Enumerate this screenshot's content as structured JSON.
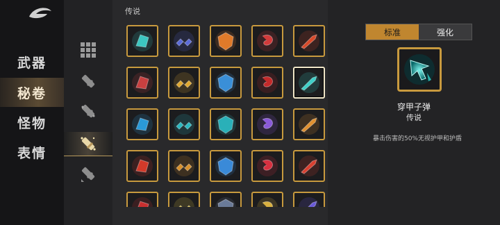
{
  "sidebar": {
    "items": [
      {
        "label": "武器"
      },
      {
        "label": "秘卷"
      },
      {
        "label": "怪物"
      },
      {
        "label": "表情"
      }
    ],
    "active_index": 1
  },
  "subcategories": {
    "icons": [
      "grid-icon",
      "bullet-icon",
      "bullet-spark-icon",
      "bullet-glow-icon",
      "bullet-arrows-icon"
    ],
    "active_index": 3
  },
  "grid": {
    "section_title": "传说",
    "items": [
      {
        "icon": "cyan-boot-icon",
        "color": "#3cc7c0"
      },
      {
        "icon": "chain-icon",
        "color": "#5a6ad8"
      },
      {
        "icon": "orange-shield-icon",
        "color": "#e07a2a"
      },
      {
        "icon": "red-teal-swirl-icon",
        "color": "#d23b3b"
      },
      {
        "icon": "red-gun-icon",
        "color": "#d94a2a"
      },
      {
        "icon": "axe-icon",
        "color": "#c84040"
      },
      {
        "icon": "gold-badge-icon",
        "color": "#e0a830"
      },
      {
        "icon": "blue-cat-icon",
        "color": "#3a8fd8"
      },
      {
        "icon": "red-target-icon",
        "color": "#c42a2a"
      },
      {
        "icon": "armor-piercing-bullet-icon",
        "color": "#3fd0c8"
      },
      {
        "icon": "blue-armor-icon",
        "color": "#2a9ad8"
      },
      {
        "icon": "teal-hook-icon",
        "color": "#2ab8c0"
      },
      {
        "icon": "teal-ring-icon",
        "color": "#2ab0b8"
      },
      {
        "icon": "purple-dash-icon",
        "color": "#8a5ad8"
      },
      {
        "icon": "fire-arrow-icon",
        "color": "#e09030"
      },
      {
        "icon": "red-slash-icon",
        "color": "#d23a2a"
      },
      {
        "icon": "gold-shield-icon",
        "color": "#d8902a"
      },
      {
        "icon": "blue-pixel-icon",
        "color": "#3a8ad8"
      },
      {
        "icon": "red-heart-icon",
        "color": "#d83040"
      },
      {
        "icon": "red-claw-icon",
        "color": "#d84030"
      },
      {
        "icon": "red-dagger-icon",
        "color": "#c83030"
      },
      {
        "icon": "gold-spark-icon",
        "color": "#e0c040"
      },
      {
        "icon": "grey-stone-icon",
        "color": "#6a7a98"
      },
      {
        "icon": "gold-swirl-icon",
        "color": "#d8b040"
      },
      {
        "icon": "purple-crystal-icon",
        "color": "#6a5ad8"
      }
    ],
    "selected_index": 9
  },
  "detail": {
    "tabs": [
      "标准",
      "强化"
    ],
    "active_tab": 0,
    "item_name": "穿甲子弹",
    "rarity": "传说",
    "description": "暴击伤害的50%无视护甲和护盾",
    "accent_color": "#c89a3e"
  }
}
